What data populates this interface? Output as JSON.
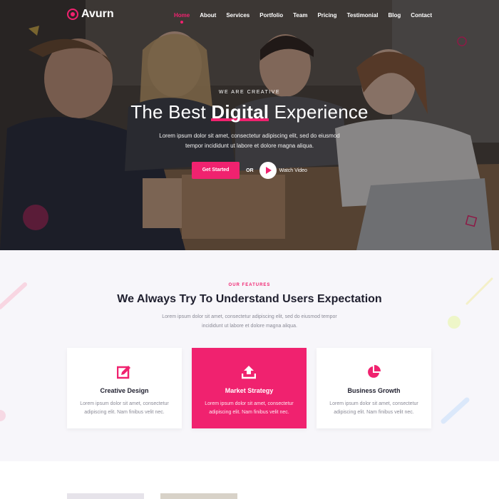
{
  "header": {
    "logo_text": "Avurn",
    "nav": [
      {
        "label": "Home",
        "active": true
      },
      {
        "label": "About"
      },
      {
        "label": "Services"
      },
      {
        "label": "Portfolio"
      },
      {
        "label": "Team"
      },
      {
        "label": "Pricing"
      },
      {
        "label": "Testimonial"
      },
      {
        "label": "Blog"
      },
      {
        "label": "Contact"
      }
    ]
  },
  "hero": {
    "eyebrow": "WE ARE CREATIVE",
    "title_pre": "The Best ",
    "title_highlight": "Digital",
    "title_post": " Experience",
    "description": "Lorem ipsum dolor sit amet, consectetur adipiscing elit, sed do eiusmod tempor incididunt ut labore et dolore magna aliqua.",
    "cta_label": "Get Started",
    "or_label": "OR",
    "video_label": "Watch Video"
  },
  "features": {
    "eyebrow": "OUR FEATURES",
    "title_pre": "We Always Try To ",
    "title_highlight": "Understand",
    "title_post": " Users Expectation",
    "description": "Lorem ipsum dolor sit amet, consectetur adipiscing elit, sed do eiusmod tempor incididunt ut labore et dolore magna aliqua.",
    "cards": [
      {
        "icon": "edit-icon",
        "title": "Creative Design",
        "text": "Lorem ipsum dolor sit amet, consectetur adipiscing elit. Nam finibus velit nec."
      },
      {
        "icon": "upload-icon",
        "title": "Market Strategy",
        "text": "Lorem ipsum dolor sit amet, consectetur adipiscing elit. Nam finibus velit nec."
      },
      {
        "icon": "pie-chart-icon",
        "title": "Business Growth",
        "text": "Lorem ipsum dolor sit amet, consectetur adipiscing elit. Nam finibus velit nec."
      }
    ]
  },
  "colors": {
    "accent": "#f0226f",
    "dark_text": "#1f1f2e",
    "muted_text": "#8a8a96",
    "section_bg": "#f7f6fa"
  }
}
